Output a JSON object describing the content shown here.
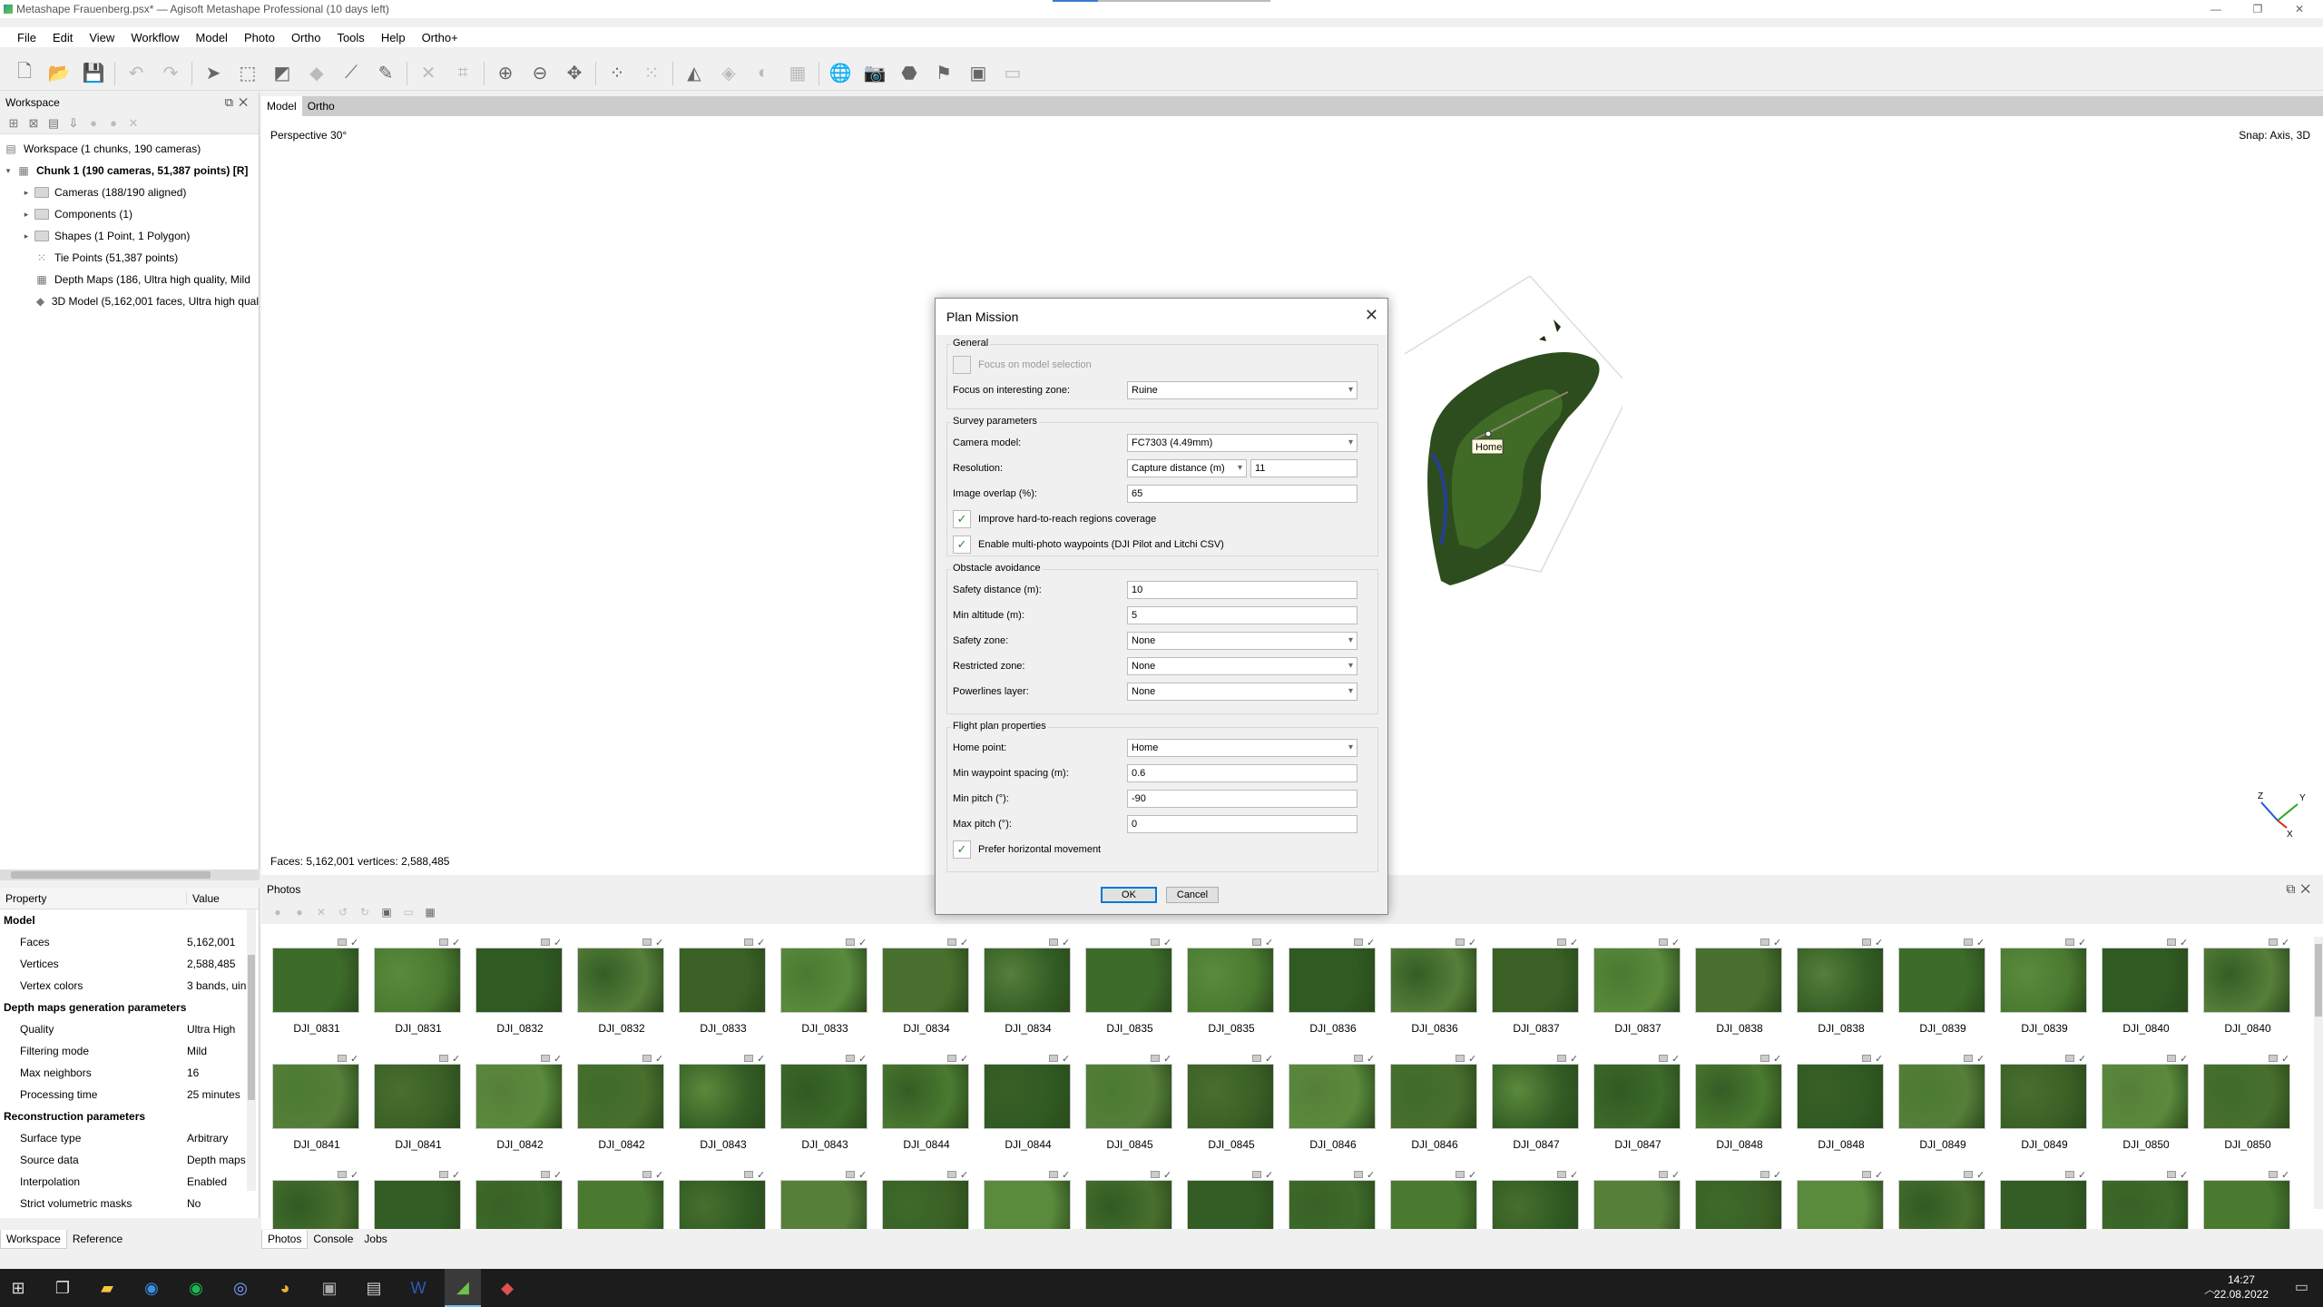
{
  "titlebar": {
    "title": "Metashape Frauenberg.psx* — Agisoft Metashape Professional (10 days left)"
  },
  "menu": [
    "File",
    "Edit",
    "View",
    "Workflow",
    "Model",
    "Photo",
    "Ortho",
    "Tools",
    "Help",
    "Ortho+"
  ],
  "workspace": {
    "header": "Workspace",
    "tree": [
      {
        "label": "Workspace (1 chunks, 190 cameras)",
        "level": 0,
        "icon": "workspace-icon"
      },
      {
        "label": "Chunk 1 (190 cameras, 51,387 points) [R]",
        "level": 0,
        "icon": "chunk-icon",
        "bold": true,
        "expand": "▾"
      },
      {
        "label": "Cameras (188/190 aligned)",
        "level": 1,
        "icon": "folder-icon",
        "expand": "▸"
      },
      {
        "label": "Components (1)",
        "level": 1,
        "icon": "folder-icon",
        "expand": "▸"
      },
      {
        "label": "Shapes (1 Point, 1 Polygon)",
        "level": 1,
        "icon": "folder-icon",
        "expand": "▸"
      },
      {
        "label": "Tie Points (51,387 points)",
        "level": 1,
        "icon": "tie-points-icon"
      },
      {
        "label": "Depth Maps (186, Ultra high quality, Mild",
        "level": 1,
        "icon": "depth-maps-icon"
      },
      {
        "label": "3D Model (5,162,001 faces, Ultra high qual",
        "level": 1,
        "icon": "model-icon"
      }
    ]
  },
  "properties": {
    "col_property": "Property",
    "col_value": "Value",
    "rows": [
      {
        "k": "Model",
        "v": "",
        "section": true
      },
      {
        "k": "Faces",
        "v": "5,162,001"
      },
      {
        "k": "Vertices",
        "v": "2,588,485"
      },
      {
        "k": "Vertex colors",
        "v": "3 bands, uin"
      },
      {
        "k": "Depth maps generation parameters",
        "v": "",
        "section": true
      },
      {
        "k": "Quality",
        "v": "Ultra High"
      },
      {
        "k": "Filtering mode",
        "v": "Mild"
      },
      {
        "k": "Max neighbors",
        "v": "16"
      },
      {
        "k": "Processing time",
        "v": "25 minutes"
      },
      {
        "k": "Reconstruction parameters",
        "v": "",
        "section": true
      },
      {
        "k": "Surface type",
        "v": "Arbitrary"
      },
      {
        "k": "Source data",
        "v": "Depth maps"
      },
      {
        "k": "Interpolation",
        "v": "Enabled"
      },
      {
        "k": "Strict volumetric masks",
        "v": "No"
      }
    ]
  },
  "left_tabs": [
    "Workspace",
    "Reference"
  ],
  "view_tabs": [
    "Model",
    "Ortho"
  ],
  "viewport": {
    "projection": "Perspective 30°",
    "snap": "Snap: Axis, 3D",
    "stats": "Faces: 5,162,001 vertices: 2,588,485",
    "home_label": "Home",
    "axis_z": "Z",
    "axis_y": "Y",
    "axis_x": "X"
  },
  "photos": {
    "header": "Photos",
    "row1": [
      "DJI_0831",
      "DJI_0831",
      "DJI_0832",
      "DJI_0832",
      "DJI_0833",
      "DJI_0833",
      "DJI_0834",
      "DJI_0834",
      "DJI_0835",
      "DJI_0835",
      "DJI_0836",
      "DJI_0836",
      "DJI_0837",
      "DJI_0837",
      "DJI_0838",
      "DJI_0838",
      "DJI_0839",
      "DJI_0839",
      "DJI_0840",
      "DJI_0840"
    ],
    "row2": [
      "DJI_0841",
      "DJI_0841",
      "DJI_0842",
      "DJI_0842",
      "DJI_0843",
      "DJI_0843",
      "DJI_0844",
      "DJI_0844",
      "DJI_0845",
      "DJI_0845",
      "DJI_0846",
      "DJI_0846",
      "DJI_0847",
      "DJI_0847",
      "DJI_0848",
      "DJI_0848",
      "DJI_0849",
      "DJI_0849",
      "DJI_0850",
      "DJI_0850"
    ]
  },
  "bottom_tabs": [
    "Photos",
    "Console",
    "Jobs"
  ],
  "dialog": {
    "title": "Plan Mission",
    "general": {
      "title": "General",
      "focus_selection": "Focus on model selection",
      "focus_zone_label": "Focus on interesting zone:",
      "focus_zone_value": "Ruine"
    },
    "survey": {
      "title": "Survey parameters",
      "camera_label": "Camera model:",
      "camera_value": "FC7303 (4.49mm)",
      "resolution_label": "Resolution:",
      "resolution_mode": "Capture distance (m)",
      "resolution_value": "11",
      "overlap_label": "Image overlap (%):",
      "overlap_value": "65",
      "improve_label": "Improve hard-to-reach regions coverage",
      "multiphoto_label": "Enable multi-photo waypoints (DJI Pilot and Litchi CSV)"
    },
    "obstacle": {
      "title": "Obstacle avoidance",
      "safety_distance_label": "Safety distance (m):",
      "safety_distance_value": "10",
      "min_altitude_label": "Min altitude (m):",
      "min_altitude_value": "5",
      "safety_zone_label": "Safety zone:",
      "safety_zone_value": "None",
      "restricted_zone_label": "Restricted zone:",
      "restricted_zone_value": "None",
      "powerlines_label": "Powerlines layer:",
      "powerlines_value": "None"
    },
    "flight": {
      "title": "Flight plan properties",
      "home_point_label": "Home point:",
      "home_point_value": "Home",
      "min_spacing_label": "Min waypoint spacing (m):",
      "min_spacing_value": "0.6",
      "min_pitch_label": "Min pitch (°):",
      "min_pitch_value": "-90",
      "max_pitch_label": "Max pitch (°):",
      "max_pitch_value": "0",
      "horizontal_label": "Prefer horizontal movement"
    },
    "ok": "OK",
    "cancel": "Cancel"
  },
  "taskbar": {
    "time": "14:27",
    "date": "22.08.2022"
  }
}
